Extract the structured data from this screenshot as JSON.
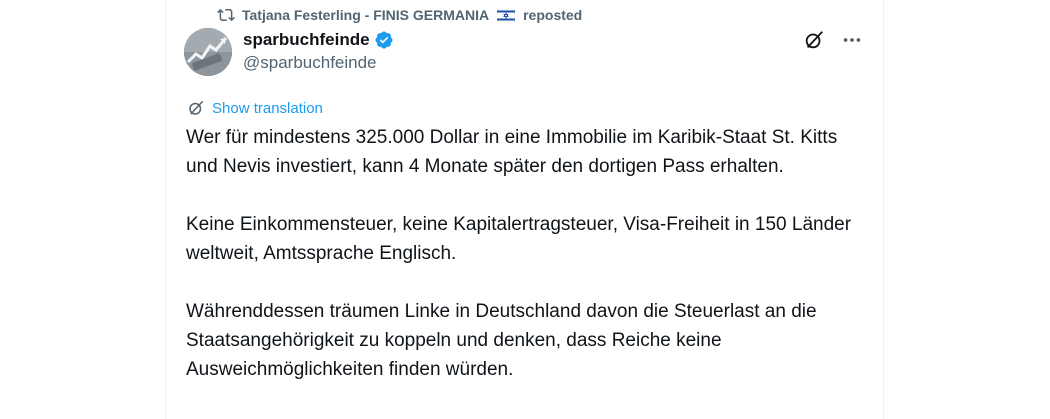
{
  "repost": {
    "user": "Tatjana Festerling - FINIS GERMANIA",
    "label": "reposted",
    "icon": "repost-icon",
    "flag_icon": "israel-flag-icon"
  },
  "post": {
    "display_name": "sparbuchfeinde",
    "handle": "@sparbuchfeinde",
    "verified": true,
    "translate_label": "Show translation",
    "paragraphs": [
      "Wer für mindestens 325.000 Dollar in eine Immobilie im Karibik-Staat St. Kitts und Nevis investiert, kann 4 Monate später den dortigen Pass erhalten.",
      "Keine Einkommensteuer, keine Kapitalertragsteuer, Visa-Freiheit in 150 Länder weltweit, Amtssprache Englisch.",
      "Währenddessen träumen Linke in Deutschland davon die Steuerlast an die Staatsangehörigkeit zu koppeln und denken, dass Reiche keine Ausweichmöglichkeiten finden würden."
    ]
  },
  "colors": {
    "accent": "#1d9bf0",
    "secondary_text": "#536471",
    "primary_text": "#0f1419"
  }
}
